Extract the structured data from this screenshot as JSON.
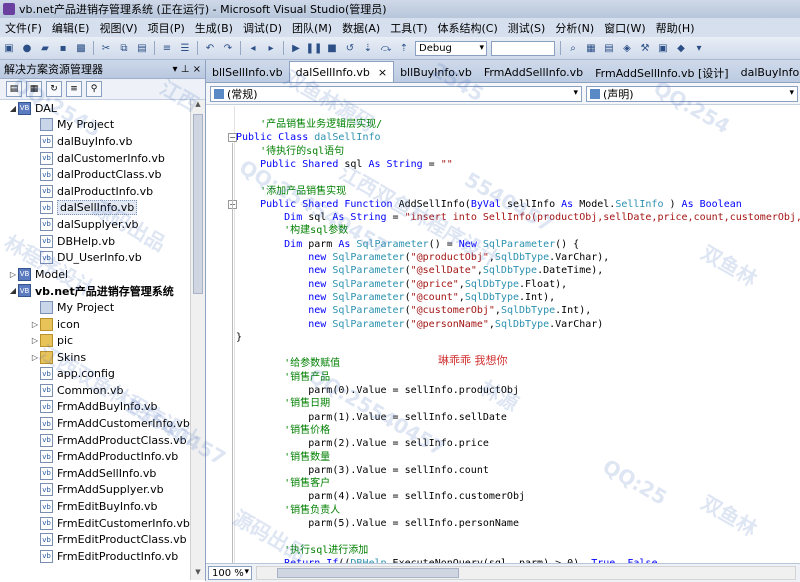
{
  "window": {
    "title": "vb.net产品进销存管理系统 (正在运行) - Microsoft Visual Studio(管理员)"
  },
  "menu": [
    "文件(F)",
    "编辑(E)",
    "视图(V)",
    "项目(P)",
    "生成(B)",
    "调试(D)",
    "团队(M)",
    "数据(A)",
    "工具(T)",
    "体系结构(C)",
    "测试(S)",
    "分析(N)",
    "窗口(W)",
    "帮助(H)"
  ],
  "toolbar": {
    "config_value": "Debug"
  },
  "solution_explorer": {
    "title": "解决方案资源管理器",
    "pin": "▾ ⊥ ×",
    "tree": [
      {
        "label": "DAL",
        "type": "proj",
        "level": 0,
        "expander": "◢"
      },
      {
        "label": "My Project",
        "type": "ref",
        "level": 1
      },
      {
        "label": "dalBuyInfo.vb",
        "type": "file",
        "level": 1
      },
      {
        "label": "dalCustomerInfo.vb",
        "type": "file",
        "level": 1
      },
      {
        "label": "dalProductClass.vb",
        "type": "file",
        "level": 1
      },
      {
        "label": "dalProductInfo.vb",
        "type": "file",
        "level": 1
      },
      {
        "label": "dalSellInfo.vb",
        "type": "file",
        "level": 1,
        "selected": true
      },
      {
        "label": "dalSupplyer.vb",
        "type": "file",
        "level": 1
      },
      {
        "label": "DBHelp.vb",
        "type": "file",
        "level": 1
      },
      {
        "label": "DU_UserInfo.vb",
        "type": "file",
        "level": 1
      },
      {
        "label": "Model",
        "type": "proj",
        "level": 0,
        "expander": "▷"
      },
      {
        "label": "vb.net产品进销存管理系统",
        "type": "proj",
        "level": 0,
        "expander": "◢",
        "bold": true
      },
      {
        "label": "My Project",
        "type": "ref",
        "level": 1
      },
      {
        "label": "icon",
        "type": "folder",
        "level": 1,
        "expander": "▷"
      },
      {
        "label": "pic",
        "type": "folder",
        "level": 1,
        "expander": "▷"
      },
      {
        "label": "Skins",
        "type": "folder",
        "level": 1,
        "expander": "▷"
      },
      {
        "label": "app.config",
        "type": "file",
        "level": 1
      },
      {
        "label": "Common.vb",
        "type": "file",
        "level": 1
      },
      {
        "label": "FrmAddBuyInfo.vb",
        "type": "file",
        "level": 1
      },
      {
        "label": "FrmAddCustomerInfo.vb",
        "type": "file",
        "level": 1
      },
      {
        "label": "FrmAddProductClass.vb",
        "type": "file",
        "level": 1
      },
      {
        "label": "FrmAddProductInfo.vb",
        "type": "file",
        "level": 1
      },
      {
        "label": "FrmAddSellInfo.vb",
        "type": "file",
        "level": 1
      },
      {
        "label": "FrmAddSupplyer.vb",
        "type": "file",
        "level": 1
      },
      {
        "label": "FrmEditBuyInfo.vb",
        "type": "file",
        "level": 1
      },
      {
        "label": "FrmEditCustomerInfo.vb",
        "type": "file",
        "level": 1
      },
      {
        "label": "FrmEditProductClass.vb",
        "type": "file",
        "level": 1
      },
      {
        "label": "FrmEditProductInfo.vb",
        "type": "file",
        "level": 1
      }
    ]
  },
  "tabs": [
    {
      "label": "bllSellInfo.vb",
      "active": false
    },
    {
      "label": "dalSellInfo.vb",
      "active": true,
      "close": "×"
    },
    {
      "label": "bllBuyInfo.vb",
      "active": false
    },
    {
      "label": "FrmAddSellInfo.vb",
      "active": false
    },
    {
      "label": "FrmAddSellInfo.vb [设计]",
      "active": false
    },
    {
      "label": "dalBuyInfo.vb",
      "active": false
    }
  ],
  "nav": {
    "left": "(常规)",
    "right": "(声明)"
  },
  "code_lines": [
    [
      [
        "cm",
        "    '产品销售业务逻辑层实现/"
      ]
    ],
    [
      [
        "kw",
        "Public Class "
      ],
      [
        "ty",
        "dalSellInfo"
      ]
    ],
    [
      [
        "cm",
        "    '待执行的sql语句"
      ]
    ],
    [
      [
        "kw",
        "    Public Shared "
      ],
      [
        "",
        "sql "
      ],
      [
        "kw",
        "As String"
      ],
      [
        "",
        " = "
      ],
      [
        "st",
        "\"\""
      ]
    ],
    [
      [
        "",
        ""
      ]
    ],
    [
      [
        "cm",
        "    '添加产品销售实现"
      ]
    ],
    [
      [
        "kw",
        "    Public Shared Function "
      ],
      [
        "",
        "AddSellInfo("
      ],
      [
        "kw",
        "ByVal "
      ],
      [
        "",
        "sellInfo "
      ],
      [
        "kw",
        "As "
      ],
      [
        "",
        "Model."
      ],
      [
        "ty",
        "SellInfo"
      ],
      [
        "",
        " ) "
      ],
      [
        "kw",
        "As Boolean"
      ]
    ],
    [
      [
        "kw",
        "        Dim "
      ],
      [
        "",
        "sql "
      ],
      [
        "kw",
        "As String"
      ],
      [
        "",
        " = "
      ],
      [
        "st",
        "\"insert into SellInfo(productObj,sellDate,price,count,customerObj,pe"
      ]
    ],
    [
      [
        "cm",
        "        '构建sql参数"
      ]
    ],
    [
      [
        "kw",
        "        Dim "
      ],
      [
        "",
        "parm "
      ],
      [
        "kw",
        "As "
      ],
      [
        "ty",
        "SqlParameter"
      ],
      [
        "",
        "() = "
      ],
      [
        "kw",
        "New "
      ],
      [
        "ty",
        "SqlParameter"
      ],
      [
        "",
        "() {"
      ]
    ],
    [
      [
        "kw",
        "            new "
      ],
      [
        "ty",
        "SqlParameter"
      ],
      [
        "",
        "("
      ],
      [
        "st",
        "\"@productObj\""
      ],
      [
        "",
        ","
      ],
      [
        "ty",
        "SqlDbType"
      ],
      [
        "",
        ".VarChar),"
      ]
    ],
    [
      [
        "kw",
        "            new "
      ],
      [
        "ty",
        "SqlParameter"
      ],
      [
        "",
        "("
      ],
      [
        "st",
        "\"@sellDate\""
      ],
      [
        "",
        ","
      ],
      [
        "ty",
        "SqlDbType"
      ],
      [
        "",
        ".DateTime),"
      ]
    ],
    [
      [
        "kw",
        "            new "
      ],
      [
        "ty",
        "SqlParameter"
      ],
      [
        "",
        "("
      ],
      [
        "st",
        "\"@price\""
      ],
      [
        "",
        ","
      ],
      [
        "ty",
        "SqlDbType"
      ],
      [
        "",
        ".Float),"
      ]
    ],
    [
      [
        "kw",
        "            new "
      ],
      [
        "ty",
        "SqlParameter"
      ],
      [
        "",
        "("
      ],
      [
        "st",
        "\"@count\""
      ],
      [
        "",
        ","
      ],
      [
        "ty",
        "SqlDbType"
      ],
      [
        "",
        ".Int),"
      ]
    ],
    [
      [
        "kw",
        "            new "
      ],
      [
        "ty",
        "SqlParameter"
      ],
      [
        "",
        "("
      ],
      [
        "st",
        "\"@customerObj\""
      ],
      [
        "",
        ","
      ],
      [
        "ty",
        "SqlDbType"
      ],
      [
        "",
        ".Int),"
      ]
    ],
    [
      [
        "kw",
        "            new "
      ],
      [
        "ty",
        "SqlParameter"
      ],
      [
        "",
        "("
      ],
      [
        "st",
        "\"@personName\""
      ],
      [
        "",
        ","
      ],
      [
        "ty",
        "SqlDbType"
      ],
      [
        "",
        ".VarChar)"
      ]
    ],
    [
      [
        "",
        "}"
      ]
    ],
    [
      [
        "",
        ""
      ]
    ],
    [
      [
        "cm",
        "        '给参数赋值"
      ]
    ],
    [
      [
        "cm",
        "        '销售产品"
      ]
    ],
    [
      [
        "",
        "            parm(0).Value = sellInfo.productObj"
      ]
    ],
    [
      [
        "cm",
        "        '销售日期"
      ]
    ],
    [
      [
        "",
        "            parm(1).Value = sellInfo.sellDate"
      ]
    ],
    [
      [
        "cm",
        "        '销售价格"
      ]
    ],
    [
      [
        "",
        "            parm(2).Value = sellInfo.price"
      ]
    ],
    [
      [
        "cm",
        "        '销售数量"
      ]
    ],
    [
      [
        "",
        "            parm(3).Value = sellInfo.count"
      ]
    ],
    [
      [
        "cm",
        "        '销售客户"
      ]
    ],
    [
      [
        "",
        "            parm(4).Value = sellInfo.customerObj"
      ]
    ],
    [
      [
        "cm",
        "        '销售负责人"
      ]
    ],
    [
      [
        "",
        "            parm(5).Value = sellInfo.personName"
      ]
    ],
    [
      [
        "",
        ""
      ]
    ],
    [
      [
        "cm",
        "        '执行sql进行添加"
      ]
    ],
    [
      [
        "kw",
        "        Return If"
      ],
      [
        "",
        "(("
      ],
      [
        "ty",
        "DBHelp"
      ],
      [
        "",
        ".ExecuteNonQuery(sql, parm) > 0), "
      ],
      [
        "kw",
        "True"
      ],
      [
        "",
        ", "
      ],
      [
        "kw",
        "False"
      ],
      [
        ")"
      ]
    ]
  ],
  "overlay_text": "琳乖乖 我想你",
  "status": {
    "zoom": "100 %"
  },
  "watermarks": [
    "QQ:2545",
    "江西",
    "双鱼林源码",
    "2545",
    "QQ:254",
    "林程序设计",
    "源码出品",
    "QQ:254540457",
    "江西双鱼林程序设计",
    "5540457",
    "双鱼林",
    "江西双鱼林程序设计",
    "25540457",
    "QQ:25540457",
    "林源",
    "QQ:25",
    "源码出品",
    "双鱼林"
  ]
}
